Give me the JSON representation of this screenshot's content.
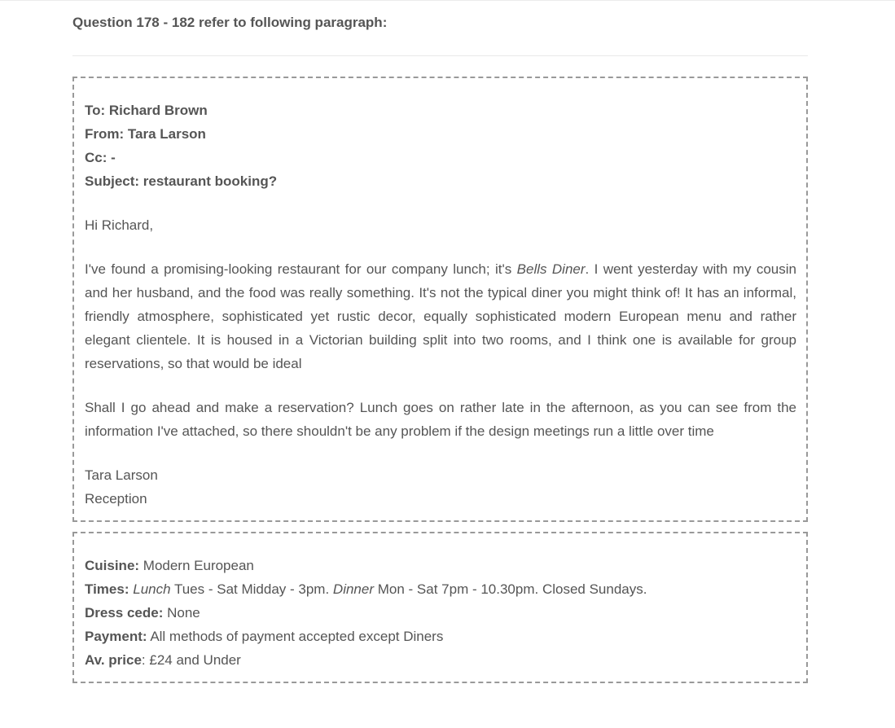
{
  "question_header": "Question 178 - 182 refer to following paragraph:",
  "email": {
    "to": "To: Richard Brown",
    "from": "From: Tara Larson",
    "cc": "Cc: -",
    "subject": "Subject: restaurant booking?",
    "greeting": "Hi Richard,",
    "para1_before": "I've found a promising-looking restaurant for our company lunch; it's ",
    "para1_italic": "Bells Diner",
    "para1_after": ". I went yesterday with my cousin and her husband, and the food was really something. It's not the typical diner you might think of! It has an informal, friendly atmosphere, sophisticated yet rustic decor, equally sophisticated modern European menu and rather elegant clientele. It is housed in a Victorian building split into two rooms, and I think one is available for group reservations, so that would be ideal",
    "para2": "Shall I go ahead and make a reservation? Lunch goes on rather late in the afternoon, as you can see from the information I've attached, so there shouldn't be any problem if the design meetings run a little over time",
    "signature_name": "Tara Larson",
    "signature_dept": "Reception"
  },
  "info": {
    "cuisine_label": "Cuisine:",
    "cuisine_value": " Modern European",
    "times_label": "Times:",
    "times_lunch": "Lunch",
    "times_lunch_value": " Tues - Sat Midday - 3pm. ",
    "times_dinner": "Dinner",
    "times_dinner_value": " Mon - Sat 7pm - 10.30pm. Closed Sundays.",
    "dress_label": "Dress cede:",
    "dress_value": " None",
    "payment_label": "Payment:",
    "payment_value": " All methods of payment accepted except Diners",
    "price_label": "Av. price",
    "price_value": ": £24 and Under"
  }
}
